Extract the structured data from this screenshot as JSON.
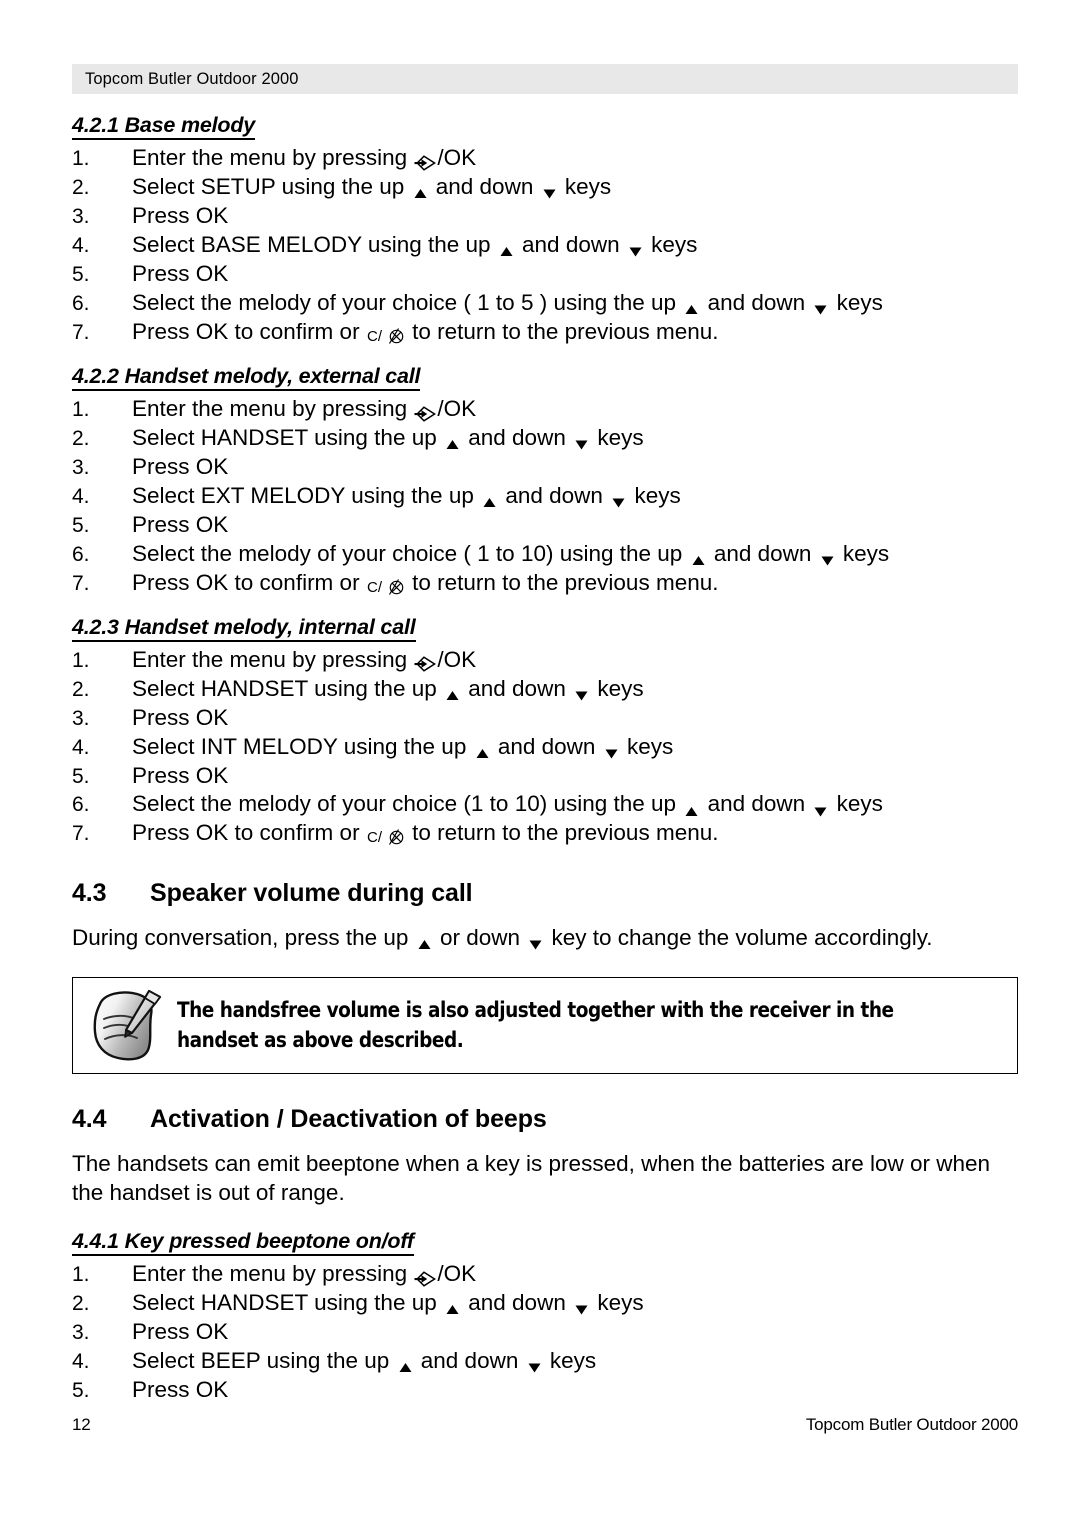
{
  "header": {
    "running_title": "Topcom Butler Outdoor 2000"
  },
  "icons": {
    "menu_ok": "menu-arrow-icon",
    "up": "up-triangle-icon",
    "down": "down-triangle-icon",
    "clear": "clear-c-icon"
  },
  "sections": [
    {
      "id": "4.2.1",
      "heading": "4.2.1 Base melody",
      "level": "sub",
      "steps": [
        {
          "n": "1.",
          "pre": "Enter the menu by pressing ",
          "icons": [
            "menu_ok"
          ],
          "post": "/OK"
        },
        {
          "n": "2.",
          "pre": "Select SETUP using the up ",
          "mid": " and down ",
          "post": " keys"
        },
        {
          "n": "3.",
          "pre": "Press OK"
        },
        {
          "n": "4.",
          "pre": "Select BASE MELODY using the up ",
          "mid": " and down ",
          "post": " keys"
        },
        {
          "n": "5.",
          "pre": "Press OK"
        },
        {
          "n": "6.",
          "pre": "Select the melody of your choice ( 1 to 5 ) using the up ",
          "mid": " and down ",
          "post": " keys"
        },
        {
          "n": "7.",
          "pre": "Press OK to confirm or ",
          "post": " to return to the previous menu."
        }
      ]
    },
    {
      "id": "4.2.2",
      "heading": "4.2.2 Handset melody, external call",
      "level": "sub",
      "steps": [
        {
          "n": "1.",
          "pre": "Enter the menu by pressing ",
          "post": "/OK"
        },
        {
          "n": "2.",
          "pre": "Select HANDSET using the up ",
          "mid": " and down ",
          "post": " keys"
        },
        {
          "n": "3.",
          "pre": "Press OK"
        },
        {
          "n": "4.",
          "pre": "Select EXT MELODY using the up ",
          "mid": " and down ",
          "post": " keys"
        },
        {
          "n": "5.",
          "pre": "Press OK"
        },
        {
          "n": "6.",
          "pre": "Select the melody of your choice ( 1 to 10) using the up ",
          "mid": " and down ",
          "post": " keys"
        },
        {
          "n": "7.",
          "pre": "Press OK to confirm or ",
          "post": " to return to the previous menu."
        }
      ]
    },
    {
      "id": "4.2.3",
      "heading": "4.2.3 Handset melody, internal call",
      "level": "sub",
      "steps": [
        {
          "n": "1.",
          "pre": "Enter the menu by pressing ",
          "post": "/OK"
        },
        {
          "n": "2.",
          "pre": "Select HANDSET using the up ",
          "mid": " and down ",
          "post": " keys"
        },
        {
          "n": "3.",
          "pre": "Press OK"
        },
        {
          "n": "4.",
          "pre": "Select INT MELODY using the up ",
          "mid": " and down ",
          "post": " keys"
        },
        {
          "n": "5.",
          "pre": "Press OK"
        },
        {
          "n": "6.",
          "pre": "Select the melody of your choice (1 to 10) using the up ",
          "mid": " and down ",
          "post": " keys"
        },
        {
          "n": "7.",
          "pre": "Press OK to confirm or ",
          "post": " to return to the previous menu."
        }
      ]
    }
  ],
  "section_4_3": {
    "number": "4.3",
    "title": "Speaker volume during call",
    "body_pre": "During conversation, press the up ",
    "body_mid": " or down ",
    "body_post": " key to change the volume accordingly."
  },
  "note": {
    "icon": "note-pencil-icon",
    "line1": "The handsfree volume is also adjusted together with the receiver in the",
    "line2": "handset as above described."
  },
  "section_4_4": {
    "number": "4.4",
    "title": "Activation / Deactivation of beeps",
    "body_line1": "The handsets can emit beeptone when a key is pressed, when the batteries are low or when",
    "body_line2": "the handset is out of range.",
    "sub": {
      "heading": "4.4.1 Key pressed beeptone on/off",
      "steps": [
        {
          "n": "1.",
          "pre": "Enter the menu by pressing ",
          "post": "/OK"
        },
        {
          "n": "2.",
          "pre": "Select HANDSET using the up ",
          "mid": " and down ",
          "post": " keys"
        },
        {
          "n": "3.",
          "pre": "Press OK"
        },
        {
          "n": "4.",
          "pre": "Select BEEP using the up ",
          "mid": " and down ",
          "post": " keys"
        },
        {
          "n": "5.",
          "pre": "Press OK"
        }
      ]
    }
  },
  "footer": {
    "page_number": "12",
    "document_title": "Topcom Butler Outdoor 2000"
  }
}
